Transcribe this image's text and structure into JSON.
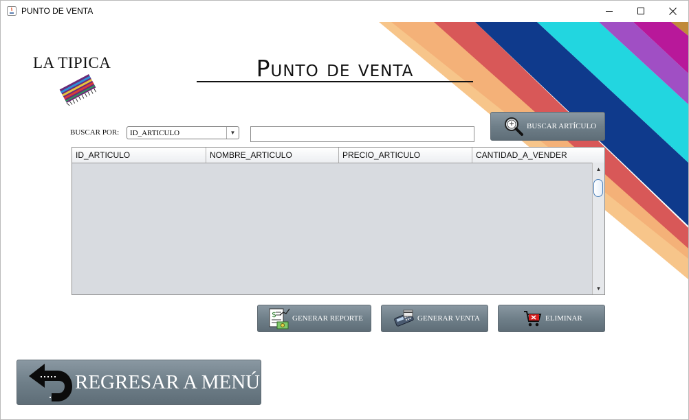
{
  "window": {
    "title": "PUNTO DE VENTA",
    "controls": [
      "minimize-icon",
      "maximize-icon",
      "close-icon"
    ]
  },
  "brand": {
    "logo_text": "LA TIPICA",
    "heading": "Punto de venta"
  },
  "search": {
    "label": "BUSCAR POR:",
    "field_selected": "ID_ARTICULO",
    "input_value": "",
    "button_label": "BUSCAR ARTÍCULO",
    "button_icon": "magnifier-icon"
  },
  "table": {
    "columns": [
      "ID_ARTICULO",
      "NOMBRE_ARTICULO",
      "PRECIO_ARTICULO",
      "CANTIDAD_A_VENDER"
    ],
    "rows": []
  },
  "actions": {
    "report_label": "GENERAR REPORTE",
    "report_icon": "report-money-icon",
    "sale_label": "GENERAR VENTA",
    "sale_icon": "card-terminal-icon",
    "delete_label": "ELIMINAR",
    "delete_icon": "cart-remove-icon",
    "back_label": "REGRESAR A MENÚ",
    "back_icon": "return-arrow-icon"
  },
  "colors": {
    "button_gradient_top": "#8a98a2",
    "button_gradient_bottom": "#5e6d77",
    "table_body": "#d8dbe0",
    "stripe_orange": "#f7c58a",
    "stripe_red": "#d85858",
    "stripe_navy": "#0f3a8c",
    "stripe_cyan": "#22d6e0",
    "stripe_purple": "#a04fc4",
    "stripe_magenta": "#b8189a"
  }
}
